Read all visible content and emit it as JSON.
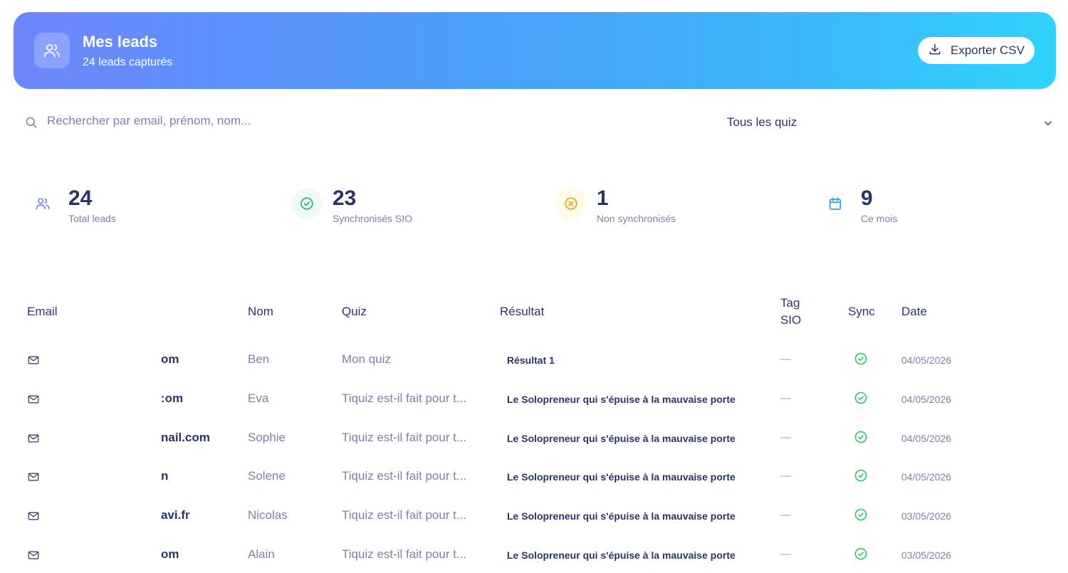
{
  "header": {
    "title": "Mes leads",
    "subtitle": "24 leads capturés",
    "icon": "users-icon",
    "export_label": "Exporter CSV",
    "gradient": [
      "#6e86fb",
      "#2fd3fb"
    ]
  },
  "search": {
    "placeholder": "Rechercher par email, prénom, nom...",
    "value": ""
  },
  "quiz_filter": {
    "selected": "Tous les quiz"
  },
  "stats": [
    {
      "value": "24",
      "label": "Total leads",
      "icon": "users-icon",
      "color": "#6e7ef5"
    },
    {
      "value": "23",
      "label": "Synchronisés SIO",
      "icon": "check-circle-icon",
      "color": "#1fb37a"
    },
    {
      "value": "1",
      "label": "Non synchronisés",
      "icon": "x-circle-icon",
      "color": "#f2a014"
    },
    {
      "value": "9",
      "label": "Ce mois",
      "icon": "calendar-icon",
      "color": "#2b9cf0"
    }
  ],
  "table": {
    "headers": {
      "email": "Email",
      "nom": "Nom",
      "quiz": "Quiz",
      "resultat": "Résultat",
      "tag_line1": "Tag",
      "tag_line2": "SIO",
      "sync": "Sync",
      "date": "Date"
    },
    "rows": [
      {
        "email": "om",
        "nom": "Ben",
        "quiz": "Mon quiz",
        "resultat": "Résultat 1",
        "tag": "—",
        "date": "04/05/2026"
      },
      {
        "email": ":om",
        "nom": "Eva",
        "quiz": "Tiquiz est-il fait pour t...",
        "resultat": "Le Solopreneur qui s'épuise à la mauvaise porte",
        "tag": "—",
        "date": "04/05/2026"
      },
      {
        "email": "nail.com",
        "nom": "Sophie",
        "quiz": "Tiquiz est-il fait pour t...",
        "resultat": "Le Solopreneur qui s'épuise à la mauvaise porte",
        "tag": "—",
        "date": "04/05/2026"
      },
      {
        "email": "n",
        "nom": "Solene",
        "quiz": "Tiquiz est-il fait pour t...",
        "resultat": "Le Solopreneur qui s'épuise à la mauvaise porte",
        "tag": "—",
        "date": "04/05/2026"
      },
      {
        "email": "avi.fr",
        "nom": "Nicolas",
        "quiz": "Tiquiz est-il fait pour t...",
        "resultat": "Le Solopreneur qui s'épuise à la mauvaise porte",
        "tag": "—",
        "date": "03/05/2026"
      },
      {
        "email": "om",
        "nom": "Alain",
        "quiz": "Tiquiz est-il fait pour t...",
        "resultat": "Le Solopreneur qui s'épuise à la mauvaise porte",
        "tag": "—",
        "date": "03/05/2026"
      }
    ],
    "sync_color": "#22c55e"
  }
}
